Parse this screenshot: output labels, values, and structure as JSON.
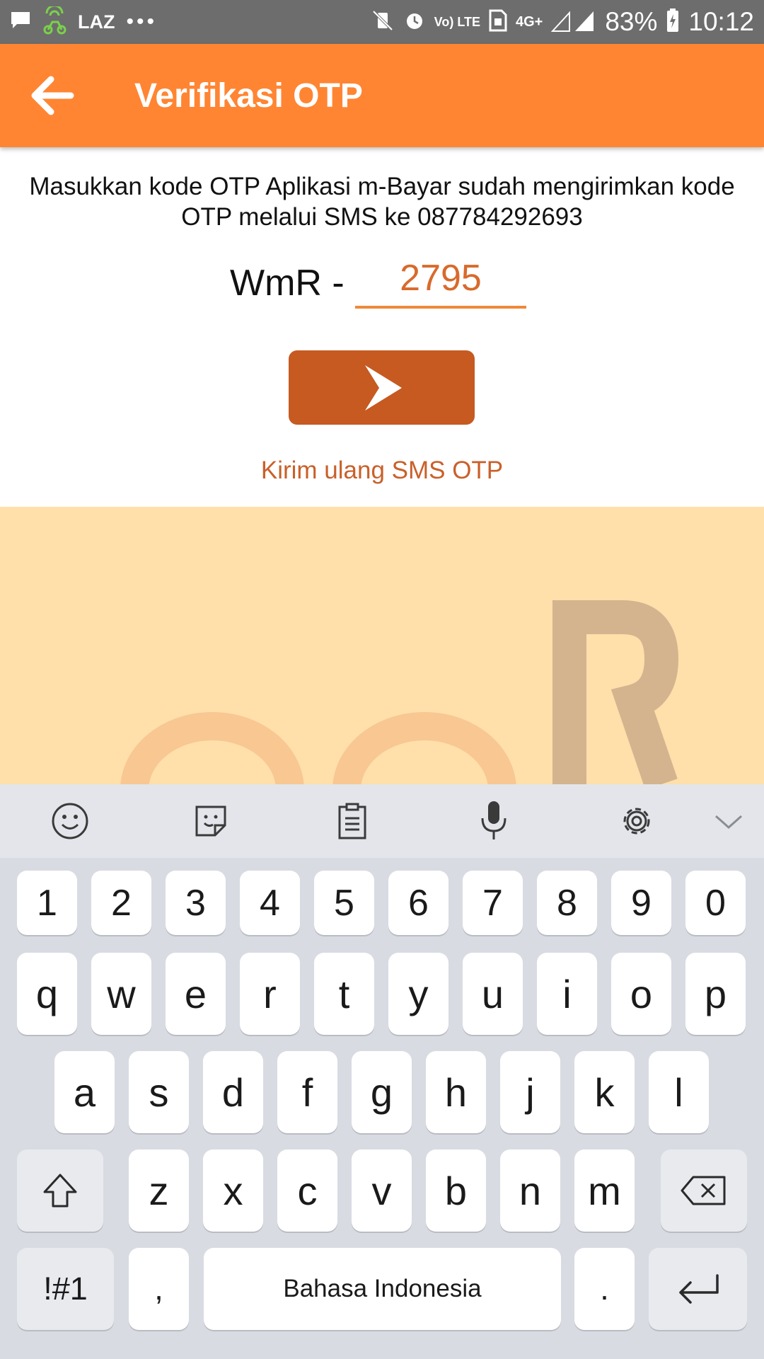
{
  "status_bar": {
    "left_text": "LAZ",
    "more_dots": "•••",
    "volte": "Vo) LTE",
    "network": "4G+",
    "battery": "83%",
    "time": "10:12",
    "icons": [
      "message-icon",
      "scooter-icon",
      "mute-vibrate-icon",
      "alarm-icon",
      "sim-icon",
      "signal-icon",
      "battery-charging-icon"
    ]
  },
  "app_bar": {
    "title": "Verifikasi OTP",
    "background": "#ff8533"
  },
  "otp": {
    "instruction": "Masukkan kode OTP Aplikasi m-Bayar sudah mengirimkan kode OTP melalui SMS ke 087784292693",
    "prefix": "WmR -",
    "value": "2795",
    "resend_label": "Kirim ulang SMS OTP",
    "accent": "#c65a21"
  },
  "keyboard": {
    "toolbar": [
      "emoji-icon",
      "sticker-icon",
      "clipboard-icon",
      "microphone-icon",
      "settings-icon",
      "collapse-keyboard-icon"
    ],
    "row_numbers": [
      "1",
      "2",
      "3",
      "4",
      "5",
      "6",
      "7",
      "8",
      "9",
      "0"
    ],
    "row1": [
      "q",
      "w",
      "e",
      "r",
      "t",
      "y",
      "u",
      "i",
      "o",
      "p"
    ],
    "row2": [
      "a",
      "s",
      "d",
      "f",
      "g",
      "h",
      "j",
      "k",
      "l"
    ],
    "row3": [
      "z",
      "x",
      "c",
      "v",
      "b",
      "n",
      "m"
    ],
    "symbols_label": "!#1",
    "comma": ",",
    "space_label": "Bahasa Indonesia",
    "period": ".",
    "special_icons": [
      "shift-icon",
      "backspace-icon",
      "enter-icon"
    ]
  }
}
